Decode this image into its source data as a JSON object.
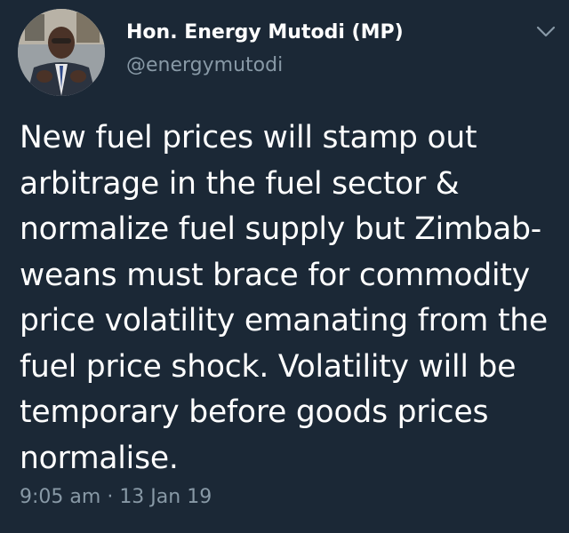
{
  "author": {
    "display_name": "Hon. Energy Mutodi (MP)",
    "handle": "@energymutodi",
    "avatar_icon": "profile-photo"
  },
  "menu": {
    "icon": "chevron-down-icon"
  },
  "tweet": {
    "text": "New fuel prices will stamp out\narbitrage in the fuel sector &\nnormalize fuel supply but Zimbab-\nweans must brace for commodity\nprice volatility emanating from the\nfuel price shock.  Volatility will be\ntemporary before goods prices\nnormalise.",
    "time": "9:05 am",
    "separator": "·",
    "date": "13 Jan 19"
  },
  "colors": {
    "background": "#1b2836",
    "primary_text": "#ffffff",
    "secondary_text": "#8899a6"
  }
}
